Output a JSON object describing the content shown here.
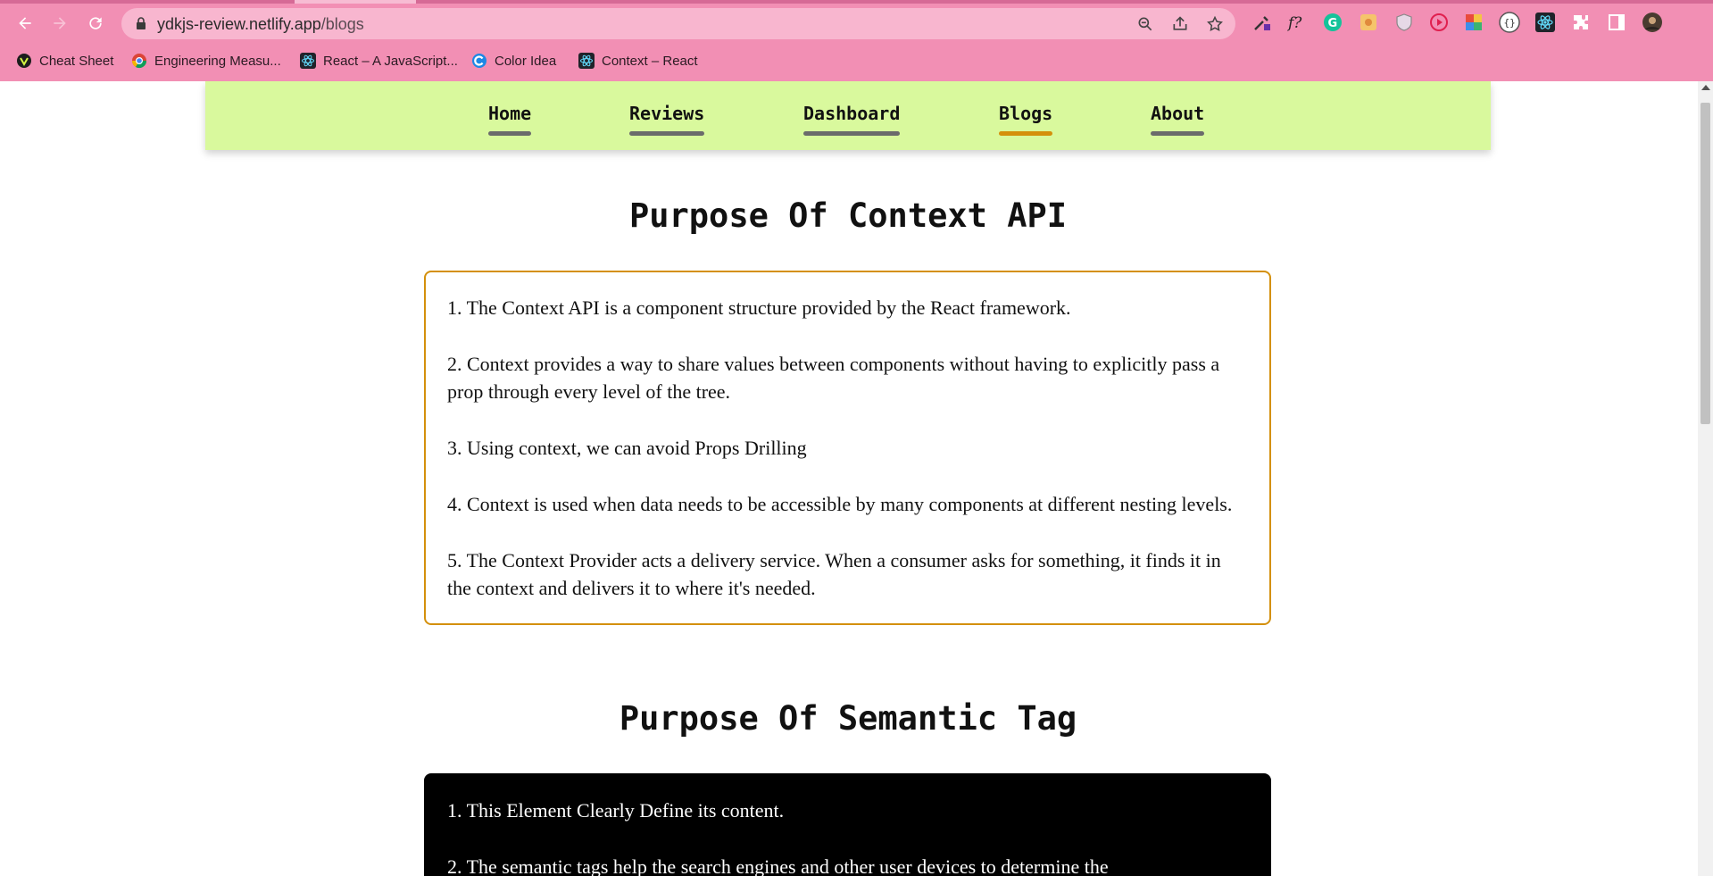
{
  "browser": {
    "url_host": "ydkjs-review.netlify.app",
    "url_path": "/blogs",
    "bookmarks": [
      {
        "label": "Cheat Sheet",
        "icon": "cheat-sheet-favicon"
      },
      {
        "label": "Engineering Measu...",
        "icon": "chrome-favicon"
      },
      {
        "label": "React – A JavaScript...",
        "icon": "react-favicon"
      },
      {
        "label": "Color Idea",
        "icon": "color-idea-favicon"
      },
      {
        "label": "Context – React",
        "icon": "react-favicon"
      }
    ]
  },
  "nav": {
    "items": [
      {
        "label": "Home"
      },
      {
        "label": "Reviews"
      },
      {
        "label": "Dashboard"
      },
      {
        "label": "Blogs"
      },
      {
        "label": "About"
      }
    ],
    "active": "Blogs"
  },
  "sections": [
    {
      "title": "Purpose Of Context API",
      "points": [
        "1. The Context API is a component structure provided by the React framework.",
        "2. Context provides a way to share values between components without having to explicitly pass a prop through every level of the tree.",
        "3. Using context, we can avoid Props Drilling",
        "4. Context is used when data needs to be accessible by many components at different nesting levels.",
        "5. The Context Provider acts a delivery service. When a consumer asks for something, it finds it in the context and delivers it to where it's needed."
      ]
    },
    {
      "title": "Purpose Of Semantic Tag",
      "points": [
        "1. This Element Clearly Define its content.",
        "2. The semantic tags help the search engines and other user devices to determine the"
      ]
    }
  ],
  "colors": {
    "chrome": "#f28fb4",
    "navbar": "#d9f99d",
    "accent": "#d4900c"
  }
}
